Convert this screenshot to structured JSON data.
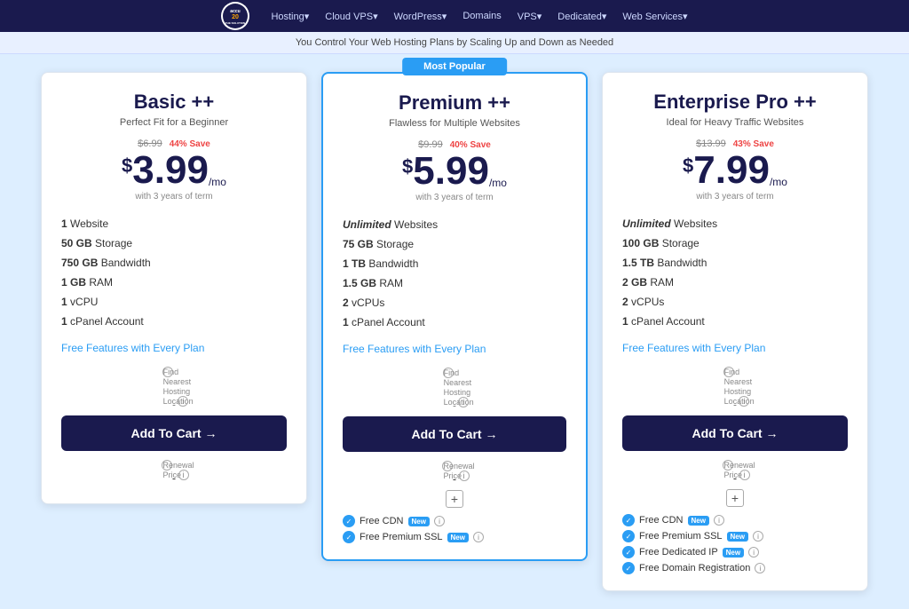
{
  "nav": {
    "logo_text": "accu20",
    "items": [
      {
        "label": "Hosting▾",
        "id": "nav-hosting"
      },
      {
        "label": "Cloud VPS▾",
        "id": "nav-cloud"
      },
      {
        "label": "WordPress▾",
        "id": "nav-wordpress"
      },
      {
        "label": "Domains",
        "id": "nav-domains"
      },
      {
        "label": "VPS▾",
        "id": "nav-vps"
      },
      {
        "label": "Dedicated▾",
        "id": "nav-dedicated"
      },
      {
        "label": "Web Services▾",
        "id": "nav-webservices"
      }
    ]
  },
  "subtitle": "You Control Your Web Hosting Plans by Scaling Up and Down as Needed",
  "plans": [
    {
      "id": "basic",
      "name": "Basic ++",
      "subtitle": "Perfect Fit for a Beginner",
      "original_price": "$6.99",
      "save": "44% Save",
      "price": "3.99",
      "per_mo": "/mo",
      "term": "with 3 years of term",
      "features": [
        {
          "bold": "1",
          "text": " Website"
        },
        {
          "bold": "50 GB",
          "text": " Storage"
        },
        {
          "bold": "750 GB",
          "text": " Bandwidth"
        },
        {
          "bold": "1 GB",
          "text": " RAM"
        },
        {
          "bold": "1",
          "text": " vCPU"
        },
        {
          "bold": "1",
          "text": " cPanel Account"
        }
      ],
      "free_features_label": "Free Features with Every Plan",
      "find_hosting_label": "Find Nearest Hosting Location",
      "cart_label": "Add To Cart →",
      "renewal_label": "Renewal Price",
      "popular": false,
      "popular_label": "",
      "addons": [],
      "expand": false
    },
    {
      "id": "premium",
      "name": "Premium ++",
      "subtitle": "Flawless for Multiple Websites",
      "original_price": "$9.99",
      "save": "40% Save",
      "price": "5.99",
      "per_mo": "/mo",
      "term": "with 3 years of term",
      "features": [
        {
          "bold": "Unlimited",
          "text": " Websites",
          "unlimited": true
        },
        {
          "bold": "75 GB",
          "text": " Storage"
        },
        {
          "bold": "1 TB",
          "text": " Bandwidth"
        },
        {
          "bold": "1.5 GB",
          "text": " RAM"
        },
        {
          "bold": "2",
          "text": " vCPUs"
        },
        {
          "bold": "1",
          "text": " cPanel Account"
        }
      ],
      "free_features_label": "Free Features with Every Plan",
      "find_hosting_label": "Find Nearest Hosting Location",
      "cart_label": "Add To Cart →",
      "renewal_label": "Renewal Price",
      "popular": true,
      "popular_label": "Most Popular",
      "addons": [
        {
          "label": "Free CDN",
          "new": true,
          "info": true
        },
        {
          "label": "Free Premium SSL",
          "new": true,
          "info": true
        }
      ],
      "expand": true
    },
    {
      "id": "enterprise",
      "name": "Enterprise Pro ++",
      "subtitle": "Ideal for Heavy Traffic Websites",
      "original_price": "$13.99",
      "save": "43% Save",
      "price": "7.99",
      "per_mo": "/mo",
      "term": "with 3 years of term",
      "features": [
        {
          "bold": "Unlimited",
          "text": " Websites",
          "unlimited": true
        },
        {
          "bold": "100 GB",
          "text": " Storage"
        },
        {
          "bold": "1.5 TB",
          "text": " Bandwidth"
        },
        {
          "bold": "2 GB",
          "text": " RAM"
        },
        {
          "bold": "2",
          "text": " vCPUs"
        },
        {
          "bold": "1",
          "text": " cPanel Account"
        }
      ],
      "free_features_label": "Free Features with Every Plan",
      "find_hosting_label": "Find Nearest Hosting Location",
      "cart_label": "Add To Cart →",
      "renewal_label": "Renewal Price",
      "popular": false,
      "popular_label": "",
      "addons": [
        {
          "label": "Free CDN",
          "new": true,
          "info": true
        },
        {
          "label": "Free Premium SSL",
          "new": true,
          "info": true
        },
        {
          "label": "Free Dedicated IP",
          "new": true,
          "info": true
        },
        {
          "label": "Free Domain Registration",
          "new": false,
          "info": true
        }
      ],
      "expand": true
    }
  ]
}
